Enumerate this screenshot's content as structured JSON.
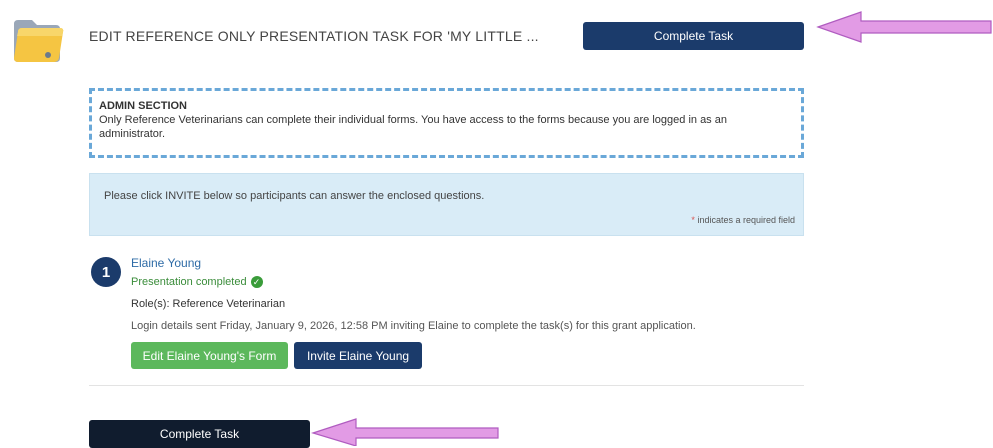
{
  "header": {
    "title": "EDIT REFERENCE ONLY PRESENTATION TASK FOR 'MY LITTLE ...",
    "complete_label": "Complete Task",
    "icon": "folder-icon"
  },
  "admin": {
    "heading": "ADMIN SECTION",
    "text": "Only Reference Veterinarians can complete their individual forms. You have access to the forms because you are logged in as an administrator."
  },
  "info": {
    "text": "Please click INVITE below so participants can answer the enclosed questions.",
    "required_star": "*",
    "required_text": " indicates a required field"
  },
  "participant": {
    "number": "1",
    "name": "Elaine Young",
    "status": "Presentation completed",
    "role": "Role(s): Reference Veterinarian",
    "login": "Login details sent Friday, January 9, 2026, 12:58 PM inviting Elaine to complete the task(s) for this grant application.",
    "edit_label": "Edit Elaine Young's Form",
    "invite_label": "Invite Elaine Young"
  },
  "footer": {
    "complete_label": "Complete Task"
  },
  "colors": {
    "navy": "#1b3b6b",
    "green": "#5cb85c",
    "arrow": "#e29be5"
  }
}
